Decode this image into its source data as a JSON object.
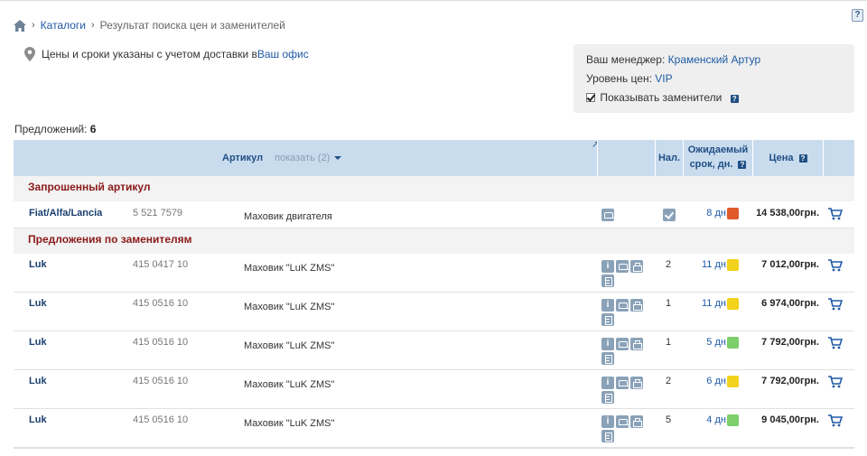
{
  "help_corner": "?",
  "breadcrumb": {
    "home_icon": "home-icon",
    "catalogs": "Каталоги",
    "current": "Результат поиска цен и заменителей"
  },
  "delivery": {
    "icon": "pin-icon",
    "text": "Цены и сроки указаны с учетом доставки в ",
    "link": "Ваш офис"
  },
  "manager": {
    "manager_label": "Ваш менеджер: ",
    "manager_name": "Краменский Артур",
    "level_label": "Уровень цен: ",
    "level_value": "VIP",
    "show_substitutes_label": "Показывать заменители",
    "show_substitutes_checked": true
  },
  "offers": {
    "label": "Предложений: ",
    "count": "6"
  },
  "table": {
    "headers": {
      "article": "Артикул",
      "show": "показать (2)",
      "stock": "Нал.",
      "term_line1": "Ожидаемый",
      "term_line2": "срок, дн.",
      "price": "Цена"
    },
    "section_requested": "Запрошенный артикул",
    "section_substitutes": "Предложения по заменителям",
    "requested_row": {
      "brand": "Fiat/Alfa/Lancia",
      "code": "5 521 7579",
      "desc": "Маховик двигателя",
      "term": "8 дн.",
      "status_color": "#e05a2b",
      "price": "14 538,00грн."
    },
    "substitute_rows": [
      {
        "brand": "Luk",
        "code": "415 0417 10",
        "desc": "Маховик \"LuK ZMS\"",
        "qty": "2",
        "term": "11 дн.",
        "status_color": "#f2d21b",
        "price": "7 012,00грн."
      },
      {
        "brand": "Luk",
        "code": "415 0516 10",
        "desc": "Маховик \"LuK ZMS\"",
        "qty": "1",
        "term": "11 дн.",
        "status_color": "#f2d21b",
        "price": "6 974,00грн."
      },
      {
        "brand": "Luk",
        "code": "415 0516 10",
        "desc": "Маховик \"LuK ZMS\"",
        "qty": "1",
        "term": "5 дн.",
        "status_color": "#7ccf6a",
        "price": "7 792,00грн."
      },
      {
        "brand": "Luk",
        "code": "415 0516 10",
        "desc": "Маховик \"LuK ZMS\"",
        "qty": "2",
        "term": "6 дн.",
        "status_color": "#f2d21b",
        "price": "7 792,00грн."
      },
      {
        "brand": "Luk",
        "code": "415 0516 10",
        "desc": "Маховик \"LuK ZMS\"",
        "qty": "5",
        "term": "4 дн.",
        "status_color": "#7ccf6a",
        "price": "9 045,00грн."
      }
    ]
  },
  "colors": {
    "header_bg": "#c9dcee",
    "link": "#1f5aa6",
    "section_title": "#8b1a1a"
  }
}
